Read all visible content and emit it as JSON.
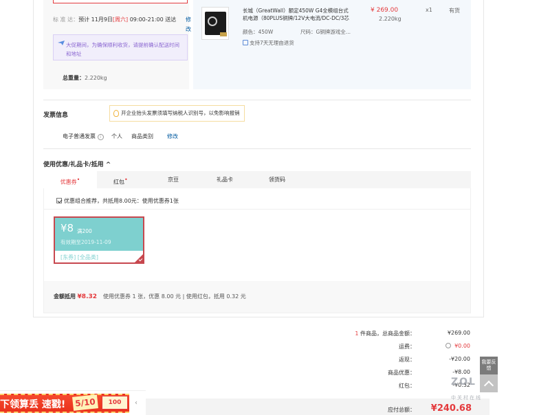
{
  "shipping": {
    "delivery_label": "标 准 达：",
    "delivery_pre": "预计 11月9日",
    "delivery_weekday": "[周六]",
    "delivery_time": " 09:00-21:00 送达",
    "edit": "修改",
    "notice": "大促期间，为确保顺利收货，请提前确认配送时间和地址",
    "weight_label": "总重量：",
    "weight_value": "2.220kg"
  },
  "product": {
    "title": "长城（GreatWall）额定450W G4全模组台式机电源（80PLUS铜牌/12V大电流/DC-DC/3芯",
    "color_label": "颜色：",
    "color_value": "450W",
    "size_label": "尺码：",
    "size_value": "G铜牌游戏全...",
    "return": "支持7天无理由退货",
    "price": "¥ 269.00",
    "weight": "2.220kg",
    "qty": "x1",
    "stock": "有货"
  },
  "invoice": {
    "title": "发票信息",
    "tip": "开企业抬头发票须填写纳税人识别号，以免影响报销",
    "type": "电子普通发票",
    "help": "i",
    "holder": "个人",
    "content": "商品类别",
    "edit": "修改"
  },
  "coupons": {
    "title": "使用优惠/礼品卡/抵用",
    "caret": "^",
    "tabs": [
      {
        "label": "优惠券",
        "dot": "•"
      },
      {
        "label": "红包",
        "dot": "•"
      },
      {
        "label": "京豆",
        "dot": ""
      },
      {
        "label": "礼品卡",
        "dot": ""
      },
      {
        "label": "领货码",
        "dot": ""
      }
    ],
    "combo": "优惠组合推荐，共抵用8.00元：使用优惠券1张",
    "coupon": {
      "amount": "¥8",
      "min": "满200",
      "expiry": "有效期至2019-11-09",
      "tags": "[东券] [全品类]"
    },
    "total_label": "金额抵用",
    "total_value": "¥8.32",
    "breakdown": "使用优惠券 1 张，优惠 8.00 元 | 使用红包，抵用 0.32 元"
  },
  "summary": {
    "count": "1",
    "goods_label": " 件商品，总商品金额：",
    "goods_value": "¥269.00",
    "shipping_label": "运费：",
    "shipping_value": "¥0.00",
    "rebate_label": "返现：",
    "rebate_value": "-¥20.00",
    "discount_label": "商品优惠：",
    "discount_value": "-¥8.00",
    "redpack_label": "红包：",
    "redpack_value": "-¥0.32",
    "total_label": "应付总额：",
    "total_value": "¥240.68"
  },
  "side": {
    "feedback": "我要反馈",
    "watermark": "ZOL",
    "watermark_sub": "中关村在线"
  },
  "promo": {
    "text": "下领算丢 速戳!",
    "date": "5/10",
    "ticket": "100"
  }
}
